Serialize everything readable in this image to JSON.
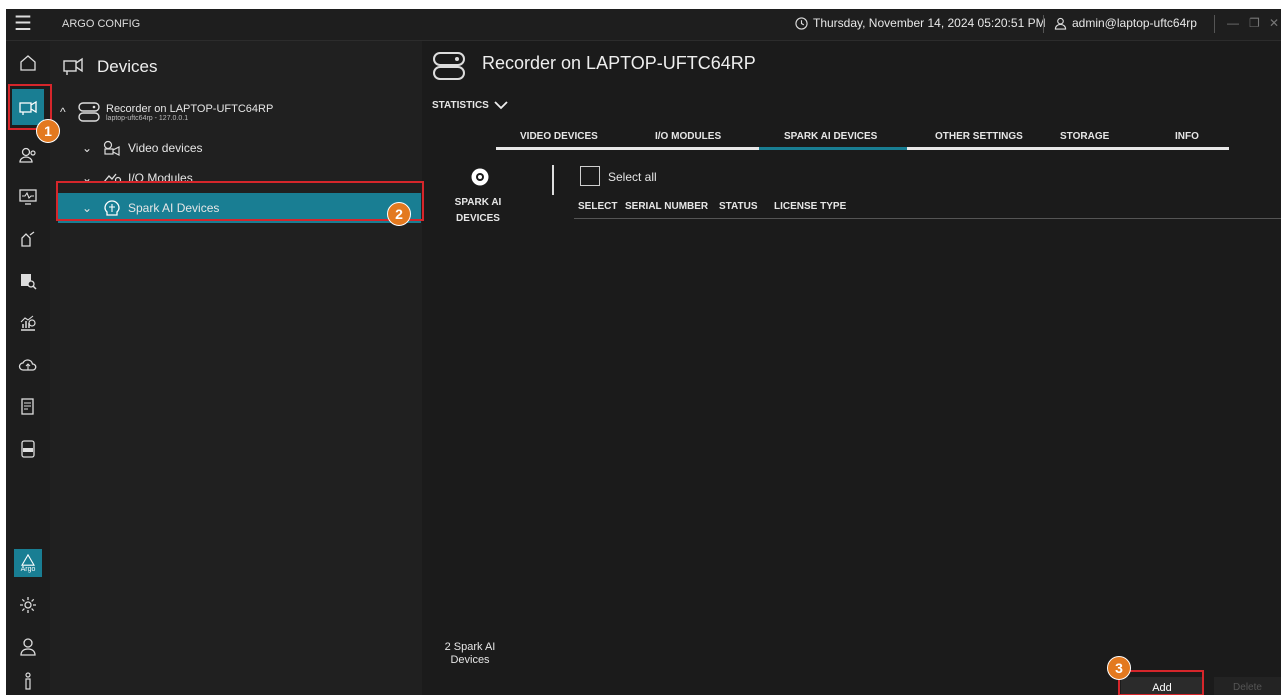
{
  "titlebar": {
    "app_title": "ARGO CONFIG",
    "datetime": "Thursday, November 14, 2024 05:20:51 PM",
    "user": "admin@laptop-uftc64rp"
  },
  "iconbar": {
    "items": [
      "home-icon",
      "devices-icon",
      "users-icon",
      "monitor-icon",
      "rules-icon",
      "search-icon",
      "analytics-icon",
      "cloud-icon",
      "report-icon",
      "log-icon"
    ],
    "bottom": [
      "argo-logo",
      "settings-icon",
      "profile-icon",
      "info-icon"
    ],
    "argo_text": "Argo"
  },
  "tree": {
    "title": "Devices",
    "recorder": {
      "label": "Recorder on LAPTOP-UFTC64RP",
      "sub": "laptop-uftc64rp - 127.0.0.1"
    },
    "video": "Video devices",
    "io": "I/O Modules",
    "spark": "Spark AI Devices"
  },
  "main": {
    "title": "Recorder on LAPTOP-UFTC64RP",
    "statistics": "STATISTICS",
    "tabs": [
      "VIDEO DEVICES",
      "I/O MODULES",
      "SPARK AI DEVICES",
      "OTHER SETTINGS",
      "STORAGE",
      "INFO"
    ],
    "active_tab": "SPARK AI DEVICES",
    "side_label_1": "SPARK AI",
    "side_label_2": "DEVICES",
    "select_all": "Select all",
    "columns": [
      "SELECT",
      "SERIAL NUMBER",
      "STATUS",
      "LICENSE TYPE"
    ],
    "count_1": "2 Spark AI",
    "count_2": "Devices",
    "add": "Add",
    "delete": "Delete"
  },
  "markers": [
    "1",
    "2",
    "3"
  ],
  "colors": {
    "accent": "#197e93",
    "marker": "#d6262b",
    "badge": "#e3791f"
  }
}
